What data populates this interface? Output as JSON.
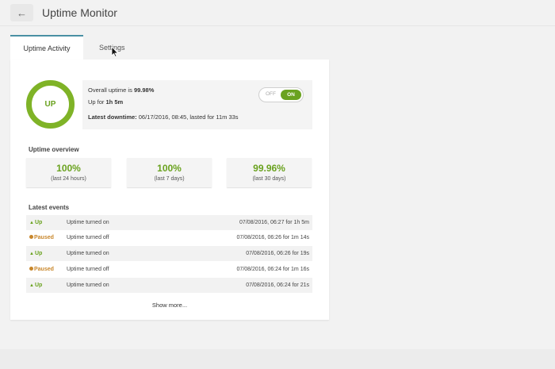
{
  "header": {
    "back_icon": "←",
    "title": "Uptime Monitor"
  },
  "tabs": [
    {
      "label": "Uptime Activity",
      "active": true
    },
    {
      "label": "Settings",
      "active": false
    }
  ],
  "status": {
    "ring_label": "UP",
    "overall_prefix": "Overall uptime is ",
    "overall_value": "99.98%",
    "up_for_prefix": "Up for ",
    "up_for_value": "1h 5m",
    "downtime_label": "Latest downtime:",
    "downtime_value": " 06/17/2016, 08:45, lasted for 11m 33s",
    "toggle_off": "OFF",
    "toggle_on": "ON"
  },
  "overview": {
    "title": "Uptime overview",
    "cards": [
      {
        "pct": "100%",
        "sub": "(last 24 hours)"
      },
      {
        "pct": "100%",
        "sub": "(last 7 days)"
      },
      {
        "pct": "99.96%",
        "sub": "(last 30 days)"
      }
    ]
  },
  "events": {
    "title": "Latest events",
    "rows": [
      {
        "status": "Up",
        "kind": "up",
        "desc": "Uptime turned on",
        "time": "07/08/2016, 06:27 for 1h 5m"
      },
      {
        "status": "Paused",
        "kind": "paused",
        "desc": "Uptime turned off",
        "time": "07/08/2016, 06:26 for 1m 14s"
      },
      {
        "status": "Up",
        "kind": "up",
        "desc": "Uptime turned on",
        "time": "07/08/2016, 06:26 for 19s"
      },
      {
        "status": "Paused",
        "kind": "paused",
        "desc": "Uptime turned off",
        "time": "07/08/2016, 06:24 for 1m 16s"
      },
      {
        "status": "Up",
        "kind": "up",
        "desc": "Uptime turned on",
        "time": "07/08/2016, 06:24 for 21s"
      }
    ],
    "show_more": "Show more..."
  },
  "colors": {
    "accent_green": "#6aa21f",
    "paused_orange": "#c8862a",
    "tab_border": "#4a90a4"
  }
}
